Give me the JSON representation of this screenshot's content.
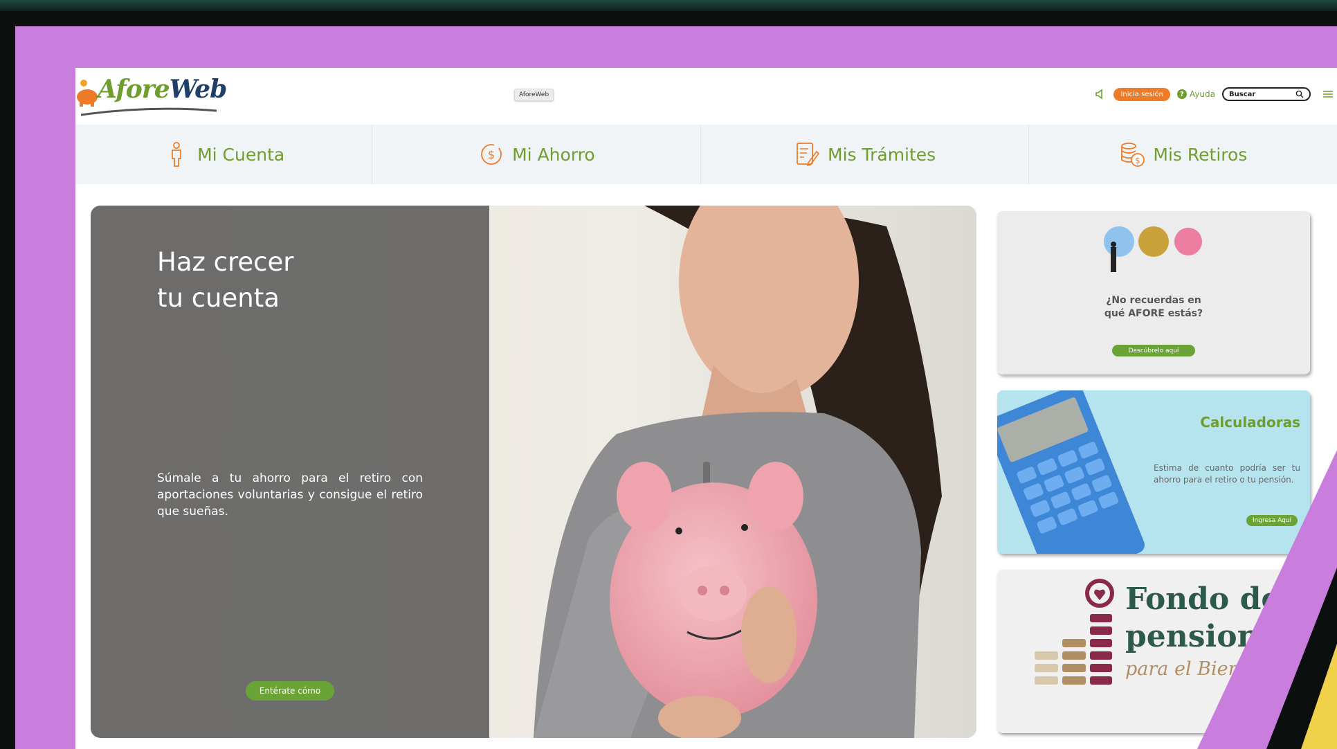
{
  "site": {
    "logo_text_a": "Afore",
    "logo_text_b": "Web",
    "center_label": "AforeWeb"
  },
  "header": {
    "login_label": "Inicia sesión",
    "help_label": "Ayuda",
    "help_icon": "?",
    "search_placeholder": "Buscar"
  },
  "nav": {
    "items": [
      {
        "label": "Mi Cuenta",
        "icon": "person-icon"
      },
      {
        "label": "Mi Ahorro",
        "icon": "dollar-cycle-icon"
      },
      {
        "label": "Mis Trámites",
        "icon": "document-edit-icon"
      },
      {
        "label": "Mis Retiros",
        "icon": "coins-icon"
      }
    ]
  },
  "hero": {
    "title": "Haz crecer\ntu cuenta",
    "text": "Súmale a tu ahorro para el retiro con aportaciones voluntarias y consigue el retiro que sueñas.",
    "button": "Entérate cómo"
  },
  "cards": [
    {
      "question": "¿No recuerdas en\nqué AFORE estás?",
      "button": "Descúbrelo aquí"
    },
    {
      "title": "Calculadoras",
      "desc": "Estima de cuanto podría ser tu ahorro para el retiro o tu pensión.",
      "button": "Ingresa Aquí"
    },
    {
      "line1": "Fondo de",
      "line2": "pensiones",
      "line3": "para el Bienestar"
    }
  ],
  "colors": {
    "frame": "#c97ddd",
    "brand_green": "#6f9e2f",
    "button_green": "#6aa336",
    "login_orange": "#ee7b28",
    "fondo_green": "#2d5a4a",
    "fondo_maroon": "#8a2a4a"
  }
}
